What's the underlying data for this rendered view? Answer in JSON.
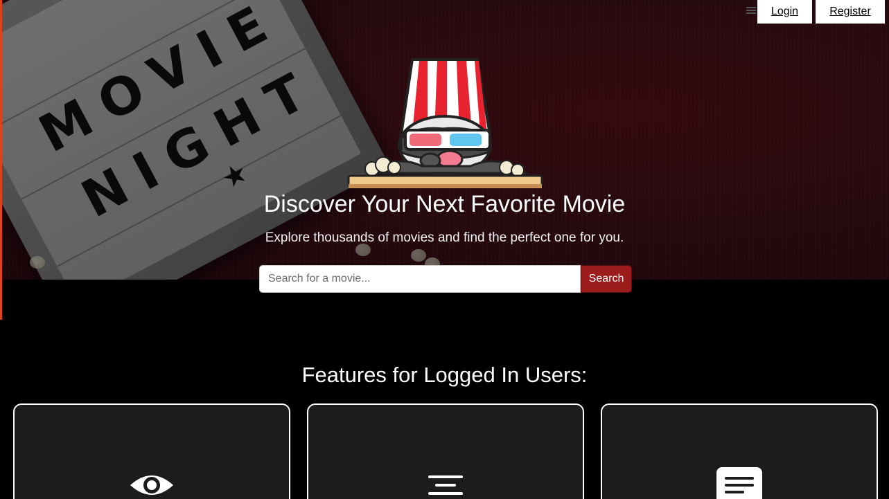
{
  "nav": {
    "login_label": "Login",
    "register_label": "Register"
  },
  "hero": {
    "background_sign_line1": "MOVIE",
    "background_sign_line2": "NIGHT",
    "title": "Discover Your Next Favorite Movie",
    "subtitle": "Explore thousands of movies and find the perfect one for you."
  },
  "search": {
    "placeholder": "Search for a movie...",
    "button_label": "Search"
  },
  "features": {
    "title": "Features for Logged In Users:",
    "cards": [
      {
        "icon": "eye-icon"
      },
      {
        "icon": "align-center-icon"
      },
      {
        "icon": "message-lines-icon"
      }
    ]
  },
  "colors": {
    "accent": "#e0401c",
    "search_button": "#9c1b1b",
    "card_background": "#1c1c1c",
    "page_background": "#000000"
  }
}
